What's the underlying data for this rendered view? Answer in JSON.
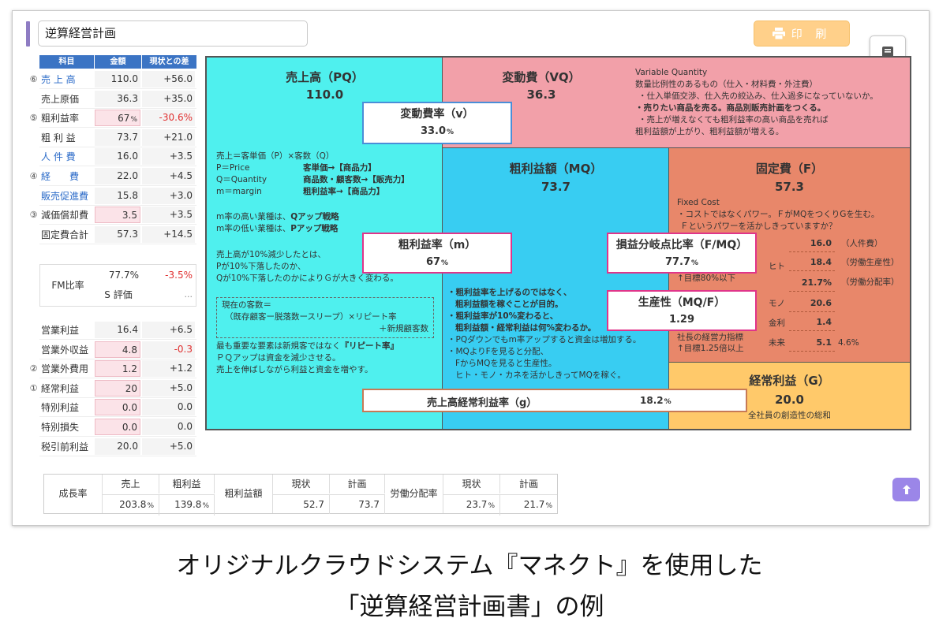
{
  "title_input": "逆算経営計画",
  "print_label": "印 刷",
  "left_table": {
    "headers": [
      "科目",
      "金額",
      "現状との差"
    ],
    "rows": [
      {
        "mark": "⑥",
        "label": "売 上 高",
        "val": "110.0",
        "diff": "+56.0",
        "blue": true
      },
      {
        "mark": "",
        "label": "売上原価",
        "val": "36.3",
        "diff": "+35.0"
      },
      {
        "mark": "⑤",
        "label": "粗利益率",
        "val": "67",
        "unit": "%",
        "diff": "-30.6%",
        "pink": true,
        "red": true
      },
      {
        "mark": "",
        "label": "粗 利 益",
        "val": "73.7",
        "diff": "+21.0"
      },
      {
        "mark": "",
        "label": "人 件 費",
        "val": "16.0",
        "diff": "+3.5",
        "blue": true
      },
      {
        "mark": "④",
        "label": "経　　費",
        "val": "22.0",
        "diff": "+4.5",
        "blue": true
      },
      {
        "mark": "",
        "label": "販売促進費",
        "val": "15.8",
        "diff": "+3.0",
        "blue": true
      },
      {
        "mark": "③",
        "label": "減価償却費",
        "val": "3.5",
        "diff": "+3.5",
        "pink": true
      },
      {
        "mark": "",
        "label": "固定費合計",
        "val": "57.3",
        "diff": "+14.5"
      }
    ],
    "fm": {
      "label": "FM比率",
      "val": "77.7%",
      "diff": "-3.5%",
      "s_label": "S 評価",
      "s_val": "..."
    },
    "rows2": [
      {
        "mark": "",
        "label": "営業利益",
        "val": "16.4",
        "diff": "+6.5"
      },
      {
        "mark": "",
        "label": "営業外収益",
        "val": "4.8",
        "diff": "-0.3",
        "pink": true,
        "red": true
      },
      {
        "mark": "②",
        "label": "営業外費用",
        "val": "1.2",
        "diff": "+1.2",
        "pink": true
      },
      {
        "mark": "①",
        "label": "経常利益",
        "val": "20",
        "diff": "+5.0",
        "pink": true
      },
      {
        "mark": "",
        "label": "特別利益",
        "val": "0.0",
        "diff": "0.0",
        "pink": true
      },
      {
        "mark": "",
        "label": "特別損失",
        "val": "0.0",
        "diff": "0.0",
        "pink": true
      },
      {
        "mark": "",
        "label": "税引前利益",
        "val": "20.0",
        "diff": "+5.0"
      }
    ]
  },
  "chart": {
    "pq": {
      "title": "売上高（PQ）",
      "val": "110.0",
      "notes1": [
        "売上＝客単価（P）×客数（Q）",
        "P＝Price",
        "Q＝Quantity",
        "m＝margin"
      ],
      "notes1b": [
        "客単価→【商品力】",
        "商品数・顧客数→【販売力】",
        "粗利益率→【商品力】"
      ],
      "notes2": [
        "m率の高い業種は、Qアップ戦略",
        "m率の低い業種は、Pアップ戦略"
      ],
      "notes3": [
        "売上高が10%減少したとは、",
        "Pが10%下落したのか、",
        "Qが10%下落したのかによりＧが大きく変わる。"
      ],
      "dash": [
        "現在の客数＝",
        "（既存顧客ー脱落数ースリープ）×リピート率",
        "＋新規顧客数"
      ],
      "notes4": [
        "最も重要な要素は新規客ではなく『リピート率』",
        "ＰＱアップは資金を減少させる。",
        "売上を伸ばしながら利益と資金を増やす。"
      ]
    },
    "vq": {
      "title": "変動費（VQ）",
      "val": "36.3",
      "notes": [
        "Variable Quantity",
        "数量比例性のあるもの（仕入・材料費・外注費）",
        "・仕入単価交渉、仕入先の絞込み、仕入過多になっていないか。",
        "・売りたい商品を売る。商品別販売計画をつくる。",
        "・売上が増えなくても粗利益率の高い商品を売れば",
        "粗利益額が上がり、粗利益額が増える。"
      ]
    },
    "v": {
      "title": "変動費率（v）",
      "val": "33.0",
      "unit": "%"
    },
    "mq": {
      "title": "粗利益額（MQ）",
      "val": "73.7",
      "notes": [
        "・粗利益率を上げるのではなく、",
        "粗利益額を稼ぐことが目的。",
        "・粗利益率が10%変わると、",
        "粗利益額・経常利益は何%変わるか。",
        "・PQダウンでもm率アップすると資金は増加する。",
        "・MQよりFを見ると分配、",
        "FからMQを見ると生産性。",
        "ヒト・モノ・カネを活かしきってMQを稼ぐ。"
      ]
    },
    "m": {
      "title": "粗利益率（m）",
      "val": "67",
      "unit": "%"
    },
    "f": {
      "title": "固定費（F）",
      "val": "57.3",
      "notes": [
        "Fixed Cost",
        "・コストではなくパワー。ＦがMQをつくりGを生む。",
        "Ｆというパワーを活かしきっていますか？"
      ]
    },
    "fmq": {
      "title": "損益分岐点比率（F/MQ）",
      "val": "77.7",
      "unit": "%",
      "sub": "↑目標80%以下"
    },
    "mqf": {
      "title": "生産性（MQ/F）",
      "val": "1.29",
      "sub1": "社長の経営力指標",
      "sub2": "↑目標1.25倍以上"
    },
    "fc": {
      "hito": "ヒト",
      "mono": "モノ",
      "kinri": "金利",
      "mirai": "未来",
      "v1": "16.0",
      "l1": "（人件費）",
      "v2": "18.4",
      "l2": "（労働生産性）",
      "v3": "21.7%",
      "l3": "（労働分配率）",
      "v4": "20.6",
      "v5": "1.4",
      "v6": "5.1",
      "l6": "4.6%"
    },
    "g": {
      "title": "経常利益（G）",
      "val": "20.0",
      "sub": "全社員の創造性の総和"
    },
    "gbar": {
      "title": "売上高経常利益率（g）",
      "val": "18.2",
      "unit": "%"
    }
  },
  "bottom": {
    "growth": "成長率",
    "sales": "売上",
    "gross": "粗利益",
    "sales_v": "203.8",
    "gross_v": "139.8",
    "mq_label": "粗利益額",
    "cur": "現状",
    "plan": "計画",
    "mq_cur": "52.7",
    "mq_plan": "73.7",
    "lab_label": "労働分配率",
    "lab_cur": "23.7",
    "lab_plan": "21.7",
    "unit": "%"
  },
  "caption": [
    "オリジナルクラウドシステム『マネクト』を使用した",
    "「逆算経営計画書」の例"
  ],
  "colors": {
    "pq": "#4ff0ee",
    "vq": "#f2a0a9",
    "mq": "#38cdf2",
    "f": "#e8876a",
    "g": "#ffc96a",
    "blue_box": "#4a8ed8",
    "pink_box": "#e0358a",
    "brown_box": "#c77a56"
  }
}
